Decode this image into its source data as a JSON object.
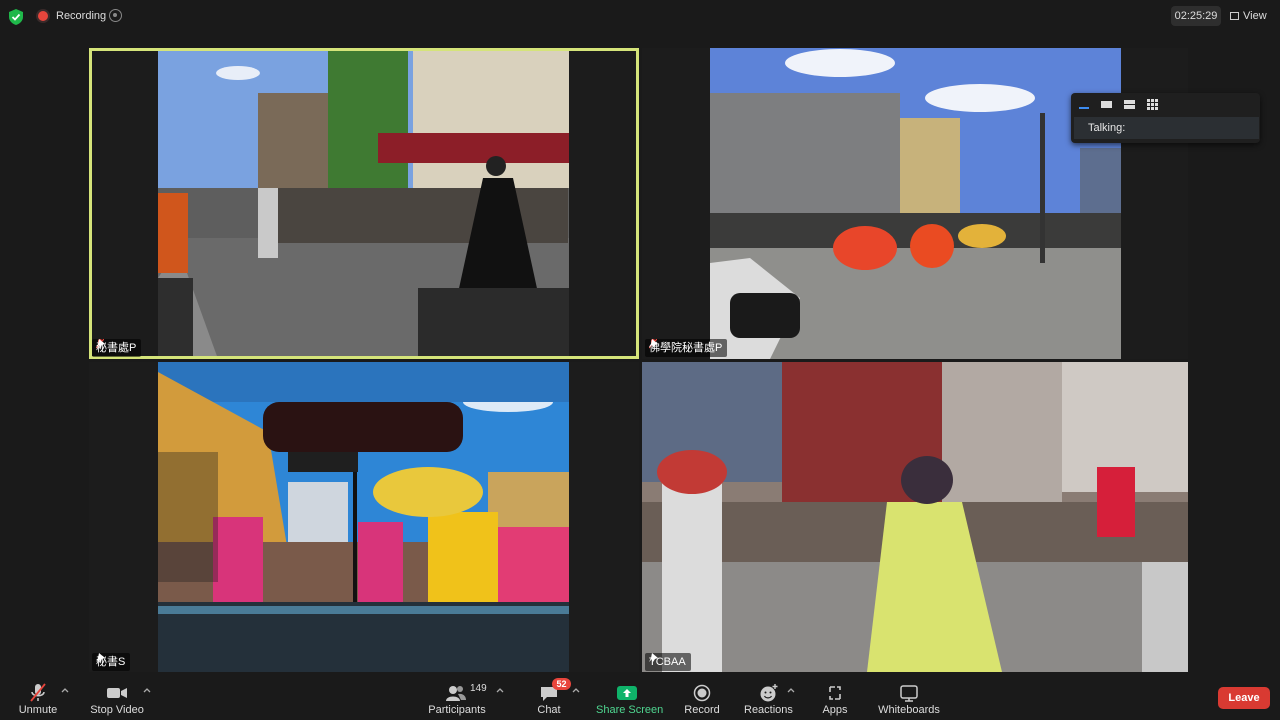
{
  "topbar": {
    "recording_label": "Recording",
    "timer": "02:25:29",
    "view_label": "View"
  },
  "tiles": [
    {
      "name": "秘書處P",
      "muted": true,
      "pinned": true,
      "active_speaker": true
    },
    {
      "name": "佛學院秘書處P",
      "muted": true,
      "pinned": true,
      "active_speaker": false
    },
    {
      "name": "秘書S",
      "muted": false,
      "pinned": true,
      "active_speaker": false
    },
    {
      "name": "TCBAA",
      "muted": false,
      "pinned": true,
      "active_speaker": false
    }
  ],
  "layout_popup": {
    "talking_label": "Talking:"
  },
  "toolbar": {
    "unmute": "Unmute",
    "stop_video": "Stop Video",
    "participants": "Participants",
    "participants_count": "149",
    "chat": "Chat",
    "chat_badge": "52",
    "share_screen": "Share Screen",
    "record": "Record",
    "reactions": "Reactions",
    "apps": "Apps",
    "whiteboards": "Whiteboards",
    "leave": "Leave"
  },
  "colors": {
    "active_speaker_border": "#d5e47a",
    "share_green": "#0fb36a",
    "leave_red": "#d93a32",
    "recording_red": "#e8453c",
    "shield_green": "#1fb84a"
  },
  "icons": [
    "shield-icon",
    "recording-icon",
    "record-control-icon",
    "view-grid-icon",
    "mic-muted-icon",
    "pin-icon",
    "video-icon",
    "participants-icon",
    "chat-icon",
    "share-screen-icon",
    "record-icon",
    "reactions-icon",
    "apps-icon",
    "whiteboard-icon"
  ]
}
